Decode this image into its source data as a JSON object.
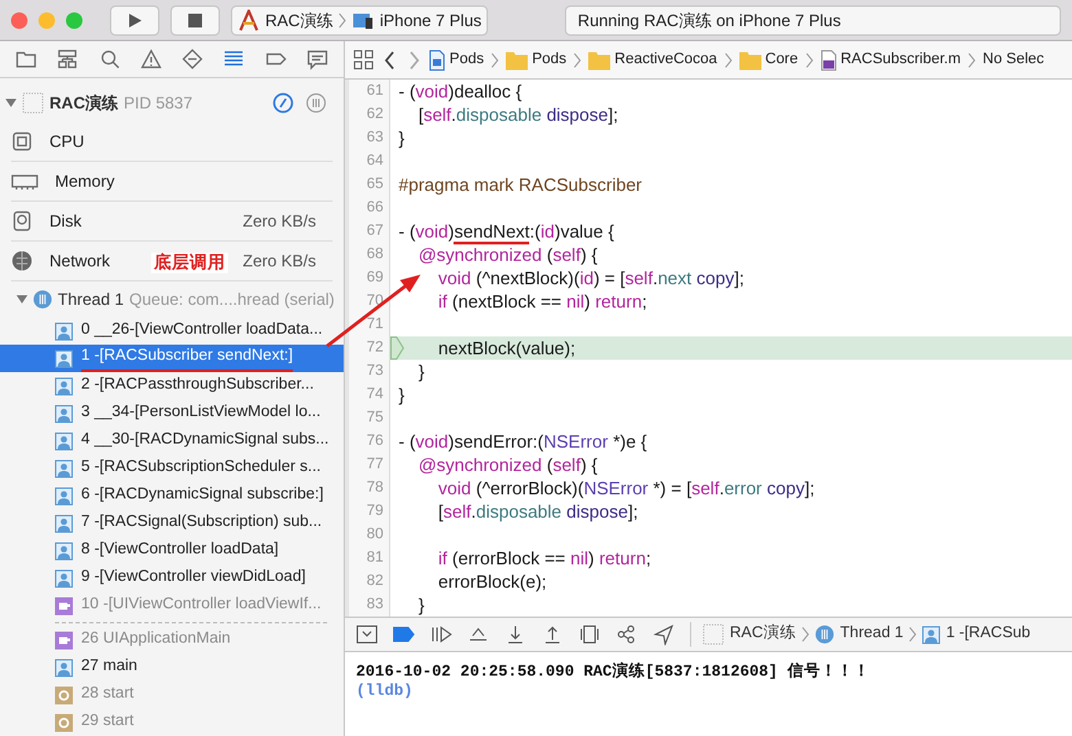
{
  "toolbar": {
    "scheme": {
      "target": "RAC演练",
      "device": "iPhone 7 Plus"
    },
    "status": "Running RAC演练 on iPhone 7 Plus"
  },
  "navigator_tabs": [
    {
      "kind": "folder",
      "selected": false
    },
    {
      "kind": "hierarchy",
      "selected": false
    },
    {
      "kind": "search",
      "selected": false
    },
    {
      "kind": "warning",
      "selected": false
    },
    {
      "kind": "diamond",
      "selected": false
    },
    {
      "kind": "list",
      "selected": true
    },
    {
      "kind": "tag",
      "selected": false
    },
    {
      "kind": "message",
      "selected": false
    }
  ],
  "process": {
    "name": "RAC演练",
    "pid": "PID 5837"
  },
  "gauges": [
    {
      "kind": "cpu",
      "label": "CPU"
    },
    {
      "kind": "memory",
      "label": "Memory"
    },
    {
      "kind": "disk",
      "label": "Disk",
      "value": "Zero KB/s"
    },
    {
      "kind": "network",
      "label": "Network",
      "value": "Zero KB/s"
    }
  ],
  "thread": {
    "name": "Thread 1",
    "queue": "Queue: com....hread (serial)",
    "expanded": true,
    "frames": [
      {
        "kind": "user",
        "label": "0 __26-[ViewController loadData...",
        "selected": false
      },
      {
        "kind": "user",
        "label": "1 -[RACSubscriber sendNext:]",
        "selected": true,
        "marked": true
      },
      {
        "kind": "user",
        "label": "2 -[RACPassthroughSubscriber...",
        "selected": false
      },
      {
        "kind": "user",
        "label": "3 __34-[PersonListViewModel lo...",
        "selected": false
      },
      {
        "kind": "user",
        "label": "4 __30-[RACDynamicSignal subs...",
        "selected": false
      },
      {
        "kind": "user",
        "label": "5 -[RACSubscriptionScheduler s...",
        "selected": false
      },
      {
        "kind": "user",
        "label": "6 -[RACDynamicSignal subscribe:]",
        "selected": false
      },
      {
        "kind": "user",
        "label": "7 -[RACSignal(Subscription) sub...",
        "selected": false
      },
      {
        "kind": "user",
        "label": "8 -[ViewController loadData]",
        "selected": false
      },
      {
        "kind": "user",
        "label": "9 -[ViewController viewDidLoad]",
        "selected": false
      },
      {
        "kind": "framework",
        "label": "10 -[UIViewController loadViewIf...",
        "selected": false
      },
      {
        "kind": "separator"
      },
      {
        "kind": "framework",
        "label": "26 UIApplicationMain",
        "selected": false
      },
      {
        "kind": "user",
        "label": "27 main",
        "selected": false
      },
      {
        "kind": "library",
        "label": "28 start",
        "selected": false
      },
      {
        "kind": "library",
        "label": "29 start",
        "selected": false
      }
    ]
  },
  "breadcrumb": [
    {
      "kind": "project",
      "label": "Pods"
    },
    {
      "kind": "folder",
      "label": "Pods"
    },
    {
      "kind": "folder",
      "label": "ReactiveCocoa"
    },
    {
      "kind": "folder",
      "label": "Core"
    },
    {
      "kind": "mfile",
      "label": "RACSubscriber.m"
    },
    {
      "kind": "text",
      "label": "No Selec"
    }
  ],
  "code": [
    {
      "n": "61",
      "t": [
        {
          "kind": "p",
          "text": "- ("
        },
        {
          "kind": "kw",
          "text": "void"
        },
        {
          "kind": "p",
          "text": ")dealloc {"
        }
      ]
    },
    {
      "n": "62",
      "t": [
        {
          "kind": "p",
          "text": "    ["
        },
        {
          "kind": "kw",
          "text": "self"
        },
        {
          "kind": "p",
          "text": "."
        },
        {
          "kind": "prop",
          "text": "disposable"
        },
        {
          "kind": "meth",
          "text": " dispose"
        },
        {
          "kind": "p",
          "text": "];"
        }
      ]
    },
    {
      "n": "63",
      "t": [
        {
          "kind": "p",
          "text": "}"
        }
      ]
    },
    {
      "n": "64"
    },
    {
      "n": "65",
      "t": [
        {
          "kind": "pragma",
          "text": "#pragma mark RACSubscriber"
        }
      ]
    },
    {
      "n": "66"
    },
    {
      "n": "67",
      "t": [
        {
          "kind": "p",
          "text": "- ("
        },
        {
          "kind": "kw",
          "text": "void"
        },
        {
          "kind": "p",
          "text": ")"
        },
        {
          "kind": "p",
          "text": "sendNext",
          "marked": true
        },
        {
          "kind": "p",
          "text": ":("
        },
        {
          "kind": "kw",
          "text": "id"
        },
        {
          "kind": "p",
          "text": ")value {"
        }
      ]
    },
    {
      "n": "68",
      "t": [
        {
          "kind": "kw",
          "text": "    @synchronized"
        },
        {
          "kind": "p",
          "text": " ("
        },
        {
          "kind": "kw",
          "text": "self"
        },
        {
          "kind": "p",
          "text": ") {"
        }
      ]
    },
    {
      "n": "69",
      "t": [
        {
          "kind": "kw",
          "text": "        void"
        },
        {
          "kind": "p",
          "text": " (^nextBlock)("
        },
        {
          "kind": "kw",
          "text": "id"
        },
        {
          "kind": "p",
          "text": ") = ["
        },
        {
          "kind": "kw",
          "text": "self"
        },
        {
          "kind": "p",
          "text": "."
        },
        {
          "kind": "prop",
          "text": "next"
        },
        {
          "kind": "meth",
          "text": " copy"
        },
        {
          "kind": "p",
          "text": "];"
        }
      ]
    },
    {
      "n": "70",
      "t": [
        {
          "kind": "kw",
          "text": "        if"
        },
        {
          "kind": "p",
          "text": " (nextBlock == "
        },
        {
          "kind": "kw",
          "text": "nil"
        },
        {
          "kind": "p",
          "text": ") "
        },
        {
          "kind": "kw",
          "text": "return"
        },
        {
          "kind": "p",
          "text": ";"
        }
      ]
    },
    {
      "n": "71"
    },
    {
      "n": "72",
      "current": true,
      "t": [
        {
          "kind": "p",
          "text": "        nextBlock(value);"
        }
      ]
    },
    {
      "n": "73",
      "t": [
        {
          "kind": "p",
          "text": "    }"
        }
      ]
    },
    {
      "n": "74",
      "t": [
        {
          "kind": "p",
          "text": "}"
        }
      ]
    },
    {
      "n": "75"
    },
    {
      "n": "76",
      "t": [
        {
          "kind": "p",
          "text": "- ("
        },
        {
          "kind": "kw",
          "text": "void"
        },
        {
          "kind": "p",
          "text": ")sendError:("
        },
        {
          "kind": "type",
          "text": "NSError"
        },
        {
          "kind": "p",
          "text": " *)e {"
        }
      ]
    },
    {
      "n": "77",
      "t": [
        {
          "kind": "kw",
          "text": "    @synchronized"
        },
        {
          "kind": "p",
          "text": " ("
        },
        {
          "kind": "kw",
          "text": "self"
        },
        {
          "kind": "p",
          "text": ") {"
        }
      ]
    },
    {
      "n": "78",
      "t": [
        {
          "kind": "kw",
          "text": "        void"
        },
        {
          "kind": "p",
          "text": " (^errorBlock)("
        },
        {
          "kind": "type",
          "text": "NSError"
        },
        {
          "kind": "p",
          "text": " *) = ["
        },
        {
          "kind": "kw",
          "text": "self"
        },
        {
          "kind": "p",
          "text": "."
        },
        {
          "kind": "prop",
          "text": "error"
        },
        {
          "kind": "meth",
          "text": " copy"
        },
        {
          "kind": "p",
          "text": "];"
        }
      ]
    },
    {
      "n": "79",
      "t": [
        {
          "kind": "p",
          "text": "        ["
        },
        {
          "kind": "kw",
          "text": "self"
        },
        {
          "kind": "p",
          "text": "."
        },
        {
          "kind": "prop",
          "text": "disposable"
        },
        {
          "kind": "meth",
          "text": " dispose"
        },
        {
          "kind": "p",
          "text": "];"
        }
      ]
    },
    {
      "n": "80"
    },
    {
      "n": "81",
      "t": [
        {
          "kind": "kw",
          "text": "        if"
        },
        {
          "kind": "p",
          "text": " (errorBlock == "
        },
        {
          "kind": "kw",
          "text": "nil"
        },
        {
          "kind": "p",
          "text": ") "
        },
        {
          "kind": "kw",
          "text": "return"
        },
        {
          "kind": "p",
          "text": ";"
        }
      ]
    },
    {
      "n": "82",
      "t": [
        {
          "kind": "p",
          "text": "        errorBlock(e);"
        }
      ]
    },
    {
      "n": "83",
      "t": [
        {
          "kind": "p",
          "text": "    }"
        }
      ]
    }
  ],
  "debug_bar": {
    "breakpoints_on": true,
    "path": [
      "RAC演练",
      "Thread 1",
      "1 -[RACSub"
    ]
  },
  "console": [
    {
      "kind": "output",
      "text": "2016-10-02 20:25:58.090 RAC演练[5837:1812608] 信号！！！"
    },
    {
      "kind": "prompt",
      "text": "(lldb)"
    }
  ],
  "annotation": {
    "text": "底层调用"
  }
}
